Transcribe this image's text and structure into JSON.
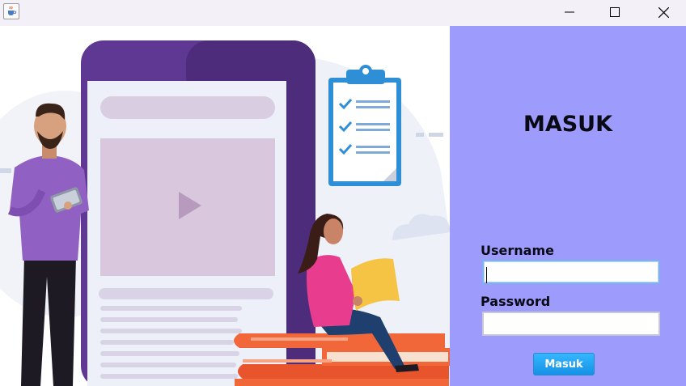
{
  "window": {
    "icon": "java-cup-icon",
    "controls": [
      "minimize-icon",
      "maximize-icon",
      "close-icon"
    ]
  },
  "illustration": {
    "icons": [
      "play-icon",
      "checklist-icon",
      "check-icon"
    ]
  },
  "login": {
    "title": "MASUK",
    "username_label": "Username",
    "username_value": "",
    "password_label": "Password",
    "password_value": "",
    "submit_label": "Masuk"
  },
  "colors": {
    "panel_bg": "#9d9bfc",
    "button_bg": "#1e9ff2",
    "phone_purple": "#5f3893",
    "person_shirt": "#9061c2",
    "girl_shirt": "#e83d8f",
    "books": "#f2673a",
    "clipboard_blue": "#2f8fd6"
  }
}
